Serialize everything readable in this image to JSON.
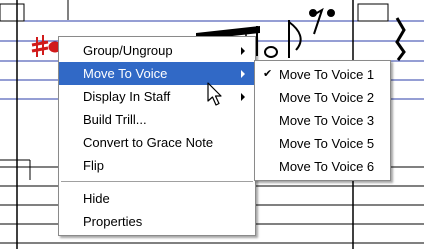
{
  "context_menu": {
    "items": [
      {
        "label": "Group/Ungroup",
        "submenu": true
      },
      {
        "label": "Move To Voice",
        "submenu": true,
        "highlighted": true
      },
      {
        "label": "Display In Staff",
        "submenu": true
      },
      {
        "label": "Build Trill..."
      },
      {
        "label": "Convert to Grace Note"
      },
      {
        "label": "Flip"
      },
      {
        "label": "Hide"
      },
      {
        "label": "Properties"
      }
    ]
  },
  "submenu": {
    "items": [
      {
        "label": "Move To Voice 1",
        "checked": true
      },
      {
        "label": "Move To Voice 2"
      },
      {
        "label": "Move To Voice 3"
      },
      {
        "label": "Move To Voice 5"
      },
      {
        "label": "Move To Voice 6"
      }
    ]
  },
  "colors": {
    "highlight": "#3169c6",
    "staff_line_blue": "#2b3ea8",
    "selected_note_red": "#d11b1b"
  },
  "icons": {
    "check": "check-icon",
    "submenu_arrow": "chevron-right-icon",
    "cursor": "mouse-pointer-icon"
  }
}
